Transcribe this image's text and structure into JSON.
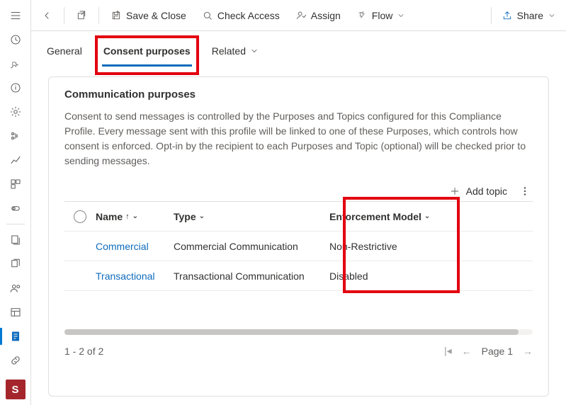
{
  "rail": {
    "badge": "S"
  },
  "cmdbar": {
    "save_close": "Save & Close",
    "check_access": "Check Access",
    "assign": "Assign",
    "flow": "Flow",
    "share": "Share"
  },
  "tabs": {
    "general": "General",
    "consent": "Consent purposes",
    "related": "Related"
  },
  "card": {
    "title": "Communication purposes",
    "desc": "Consent to send messages is controlled by the Purposes and Topics configured for this Compliance Profile. Every message sent with this profile will be linked to one of these Purposes, which controls how consent is enforced. Opt-in by the recipient to each Purposes and Topic (optional) will be checked prior to sending messages."
  },
  "actions": {
    "add_topic": "Add topic"
  },
  "columns": {
    "name": "Name",
    "type": "Type",
    "enforcement": "Enforcement Model"
  },
  "rows": [
    {
      "name": "Commercial",
      "type": "Commercial Communication",
      "enf": "Non-Restrictive"
    },
    {
      "name": "Transactional",
      "type": "Transactional Communication",
      "enf": "Disabled"
    }
  ],
  "footer": {
    "range": "1 - 2 of 2",
    "page": "Page 1"
  }
}
